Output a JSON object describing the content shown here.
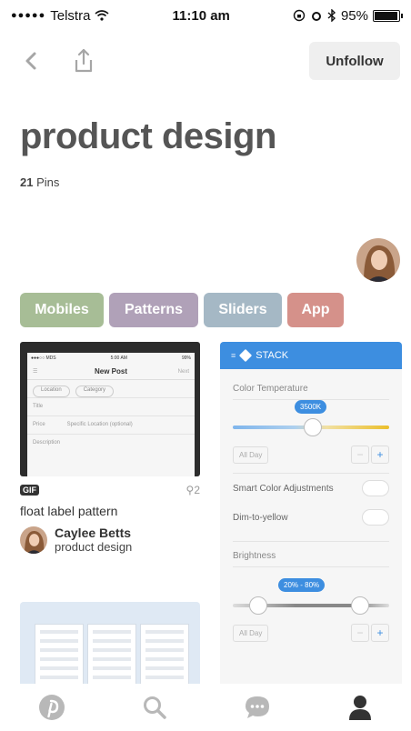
{
  "status_bar": {
    "carrier": "Telstra",
    "time": "11:10 am",
    "battery_text": "95%",
    "battery_level": 0.95
  },
  "nav": {
    "back_icon": "chevron-left-icon",
    "share_icon": "share-icon",
    "unfollow_label": "Unfollow"
  },
  "board": {
    "title": "product design",
    "pin_count": "21",
    "pin_label": "Pins"
  },
  "filters": [
    {
      "label": "Mobiles",
      "color": "#a7bd96"
    },
    {
      "label": "Patterns",
      "color": "#b0a1b8"
    },
    {
      "label": "Sliders",
      "color": "#a5b8c5"
    },
    {
      "label": "App",
      "color": "#d5918a"
    }
  ],
  "pin1": {
    "preview": {
      "carrier": "●●●○○ MDS",
      "time": "5:00 AM",
      "battery": "99%",
      "screen_title": "New Post",
      "next": "Next",
      "location": "Location",
      "category": "Category",
      "title": "Title",
      "price": "Price",
      "specific_location": "Specific Location (optional)",
      "description": "Description"
    },
    "badge": "GIF",
    "repins": "2",
    "description": "float label pattern",
    "pinner_name": "Caylee Betts",
    "pinner_board": "product design"
  },
  "pin2": {
    "app_name": "STACK",
    "color_temperature": "Color Temperature",
    "temp_value": "3500K",
    "all_day": "All Day",
    "smart_color": "Smart Color Adjustments",
    "dim_to_yellow": "Dim-to-yellow",
    "brightness": "Brightness",
    "brightness_value": "20% - 80%",
    "all_day_2": "All Day"
  },
  "tabs": [
    {
      "name": "home-tab",
      "icon": "pinterest-icon"
    },
    {
      "name": "search-tab",
      "icon": "search-icon"
    },
    {
      "name": "messages-tab",
      "icon": "chat-icon"
    },
    {
      "name": "profile-tab",
      "icon": "person-icon"
    }
  ],
  "colors": {
    "accent_blue": "#3d8ee0",
    "title_gray": "#555555",
    "tab_inactive": "#b8b8b8",
    "tab_active": "#333333"
  }
}
